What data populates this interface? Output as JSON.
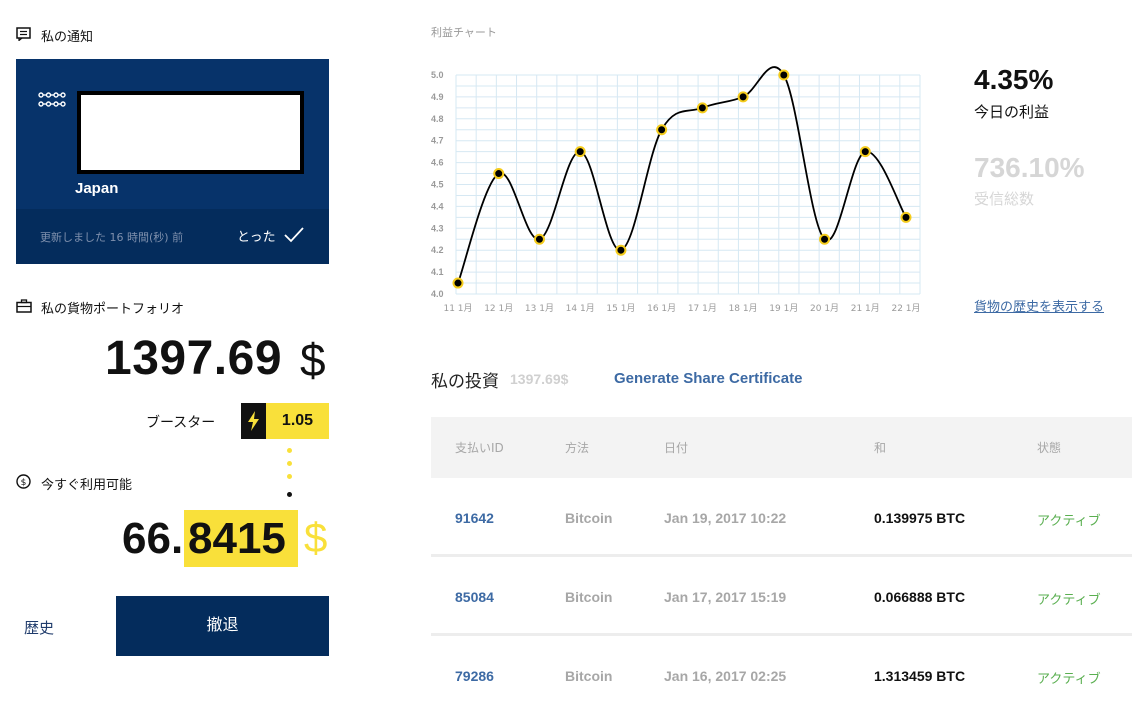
{
  "notifications": {
    "title": "私の通知",
    "country": "Japan",
    "updated": "更新しました 16 時間(秒) 前",
    "ack_label": "とった"
  },
  "portfolio": {
    "title": "私の貨物ポートフォリオ",
    "value": "1397.69",
    "currency": "$",
    "booster_label": "ブースター",
    "booster_value": "1.05"
  },
  "available": {
    "title": "今すぐ利用可能",
    "value_int": "66.",
    "value_dec": "8415",
    "currency": "$"
  },
  "actions": {
    "history": "歴史",
    "withdraw": "撤退"
  },
  "chart_data": {
    "type": "line",
    "title": "利益チャート",
    "x": [
      "11 1月",
      "12 1月",
      "13 1月",
      "14 1月",
      "15 1月",
      "16 1月",
      "17 1月",
      "18 1月",
      "19 1月",
      "20 1月",
      "21 1月",
      "22 1月"
    ],
    "series": [
      {
        "values": [
          4.05,
          4.55,
          4.25,
          4.65,
          4.2,
          4.75,
          4.85,
          4.9,
          5.0,
          4.25,
          4.65,
          4.35
        ]
      }
    ],
    "yticks": [
      "4.0",
      "4.1",
      "4.2",
      "4.3",
      "4.4",
      "4.5",
      "4.6",
      "4.7",
      "4.8",
      "4.9",
      "5.0"
    ],
    "ylim": [
      4.0,
      5.0
    ],
    "grid": true,
    "colors": {
      "line": "#000000",
      "marker_fill": "#000000",
      "marker_stroke": "#f5cc1b",
      "grid": "#d6e8f3"
    }
  },
  "stats": {
    "today_profit": "4.35%",
    "today_profit_label": "今日の利益",
    "total_received": "736.10%",
    "total_received_label": "受信総数",
    "history_link": "貨物の歴史を表示する"
  },
  "investments": {
    "title": "私の投資",
    "amount": "1397.69$",
    "certificate_link": "Generate Share Certificate",
    "columns": [
      "支払いID",
      "方法",
      "日付",
      "和",
      "状態"
    ],
    "rows": [
      {
        "id": "91642",
        "method": "Bitcoin",
        "date": "Jan 19, 2017 10:22",
        "sum": "0.139975 BTC",
        "status": "アクティブ"
      },
      {
        "id": "85084",
        "method": "Bitcoin",
        "date": "Jan 17, 2017 15:19",
        "sum": "0.066888 BTC",
        "status": "アクティブ"
      },
      {
        "id": "79286",
        "method": "Bitcoin",
        "date": "Jan 16, 2017 02:25",
        "sum": "1.313459 BTC",
        "status": "アクティブ"
      }
    ]
  },
  "colors": {
    "navy": "#07336a",
    "navy_dark": "#042c5c",
    "accent_yellow": "#f9e03a",
    "link_blue": "#3d6aa4",
    "status_green": "#5aaf50"
  }
}
